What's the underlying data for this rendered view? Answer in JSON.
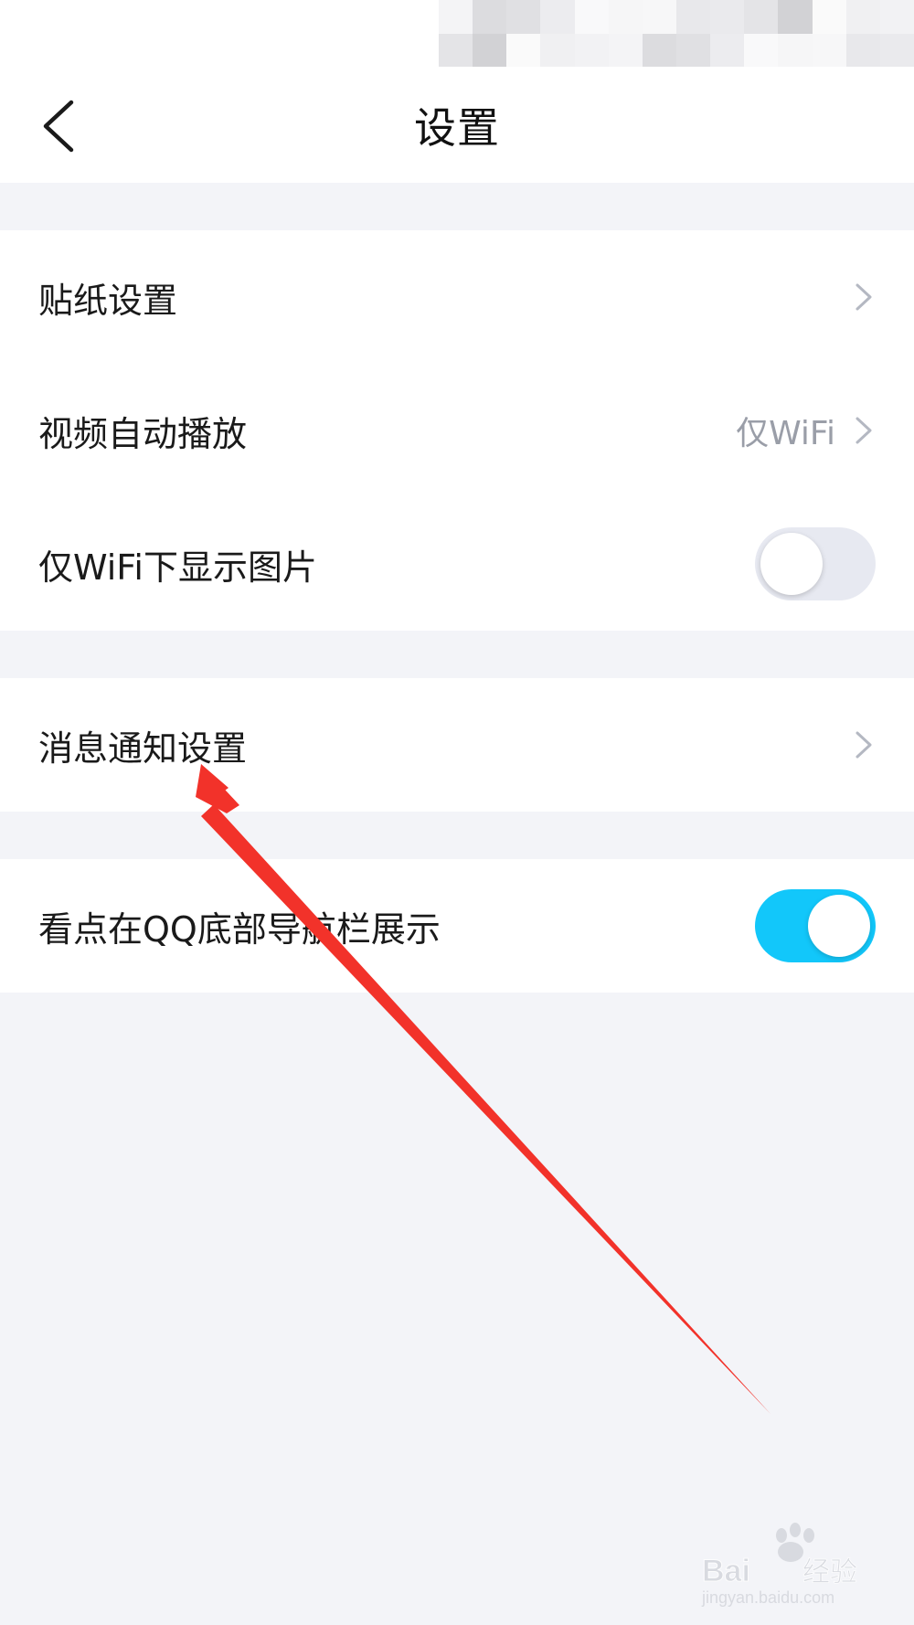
{
  "header": {
    "title": "设置",
    "back_icon": "chevron-left-icon"
  },
  "groups": [
    {
      "rows": [
        {
          "label": "贴纸设置",
          "control": "chevron"
        },
        {
          "label": "视频自动播放",
          "value": "仅WiFi",
          "control": "chevron"
        },
        {
          "label": "仅WiFi下显示图片",
          "control": "toggle",
          "checked": false
        }
      ]
    },
    {
      "rows": [
        {
          "label": "消息通知设置",
          "control": "chevron"
        }
      ]
    },
    {
      "rows": [
        {
          "label": "看点在QQ底部导航栏展示",
          "control": "toggle",
          "checked": true
        }
      ]
    }
  ],
  "colors": {
    "page_background": "#f3f4f8",
    "toggle_on": "#12c7fa",
    "toggle_off": "#e7e9f1",
    "annotation_arrow": "#f2322a"
  },
  "watermark": {
    "icon": "baidu-paw-logo",
    "brand": "Bai经验",
    "url": "jingyan.baidu.com"
  }
}
